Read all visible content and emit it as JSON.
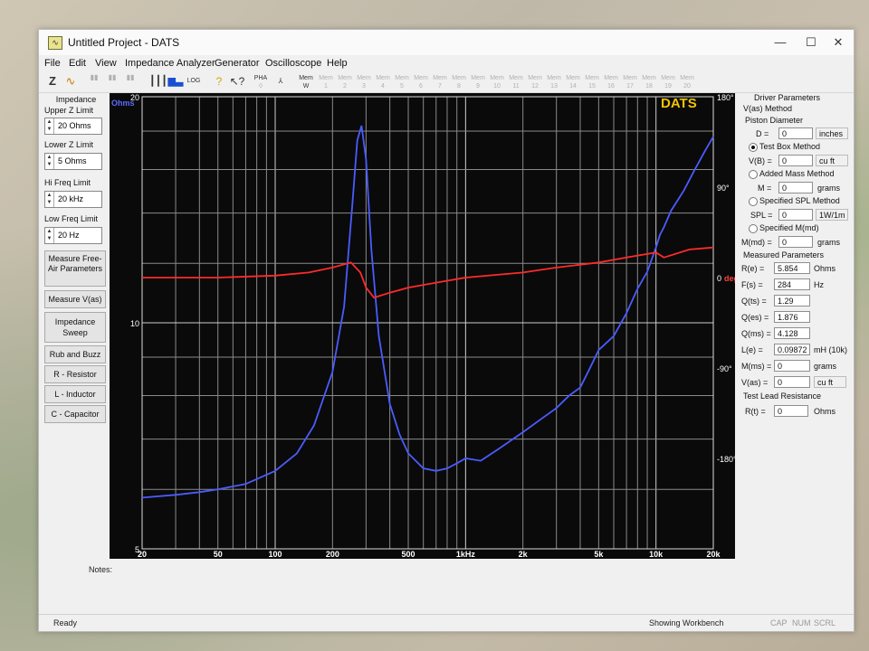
{
  "window": {
    "title": "Untitled Project - DATS",
    "app_icon": "dats-app-icon",
    "controls": [
      "—",
      "☐",
      "✕"
    ]
  },
  "menu": [
    "File",
    "Edit",
    "View",
    "Impedance Analyzer",
    "Generator",
    "Oscilloscope",
    "Help"
  ],
  "toolbar": {
    "z_label": "Z",
    "pha_label": "PHA",
    "mem_label": "Mem",
    "mem_slots": [
      "1",
      "2",
      "3",
      "4",
      "5",
      "6",
      "7",
      "8",
      "9",
      "10",
      "11",
      "12",
      "13",
      "14",
      "15",
      "16",
      "17",
      "18",
      "19",
      "20"
    ]
  },
  "sidebar": {
    "impedance_title": "Impedance",
    "upper_z_label": "Upper Z Limit",
    "upper_z_value": "20 Ohms",
    "lower_z_label": "Lower Z Limit",
    "lower_z_value": "5 Ohms",
    "hi_freq_label": "Hi Freq Limit",
    "hi_freq_value": "20 kHz",
    "low_freq_label": "Low Freq Limit",
    "low_freq_value": "20 Hz",
    "buttons": [
      "Measure Free-Air Parameters",
      "Measure V(as)",
      "Impedance Sweep",
      "Rub and Buzz",
      "R - Resistor",
      "L - Inductor",
      "C - Capacitor"
    ]
  },
  "chart_data": {
    "type": "line",
    "brand_label": "DATS",
    "ylabel": "Ohms",
    "ylabel_right": "deg",
    "x_scale": "log",
    "xlim": [
      20,
      20000
    ],
    "ylim": [
      5,
      20
    ],
    "y_scale": "log",
    "y2lim": [
      -270,
      180
    ],
    "x_ticks": [
      "20",
      "50",
      "100",
      "200",
      "500",
      "1kHz",
      "2k",
      "5k",
      "10k",
      "20k"
    ],
    "y_ticks": [
      "20",
      "10",
      "5"
    ],
    "y2_ticks": [
      "180°",
      "90°",
      "0",
      "-90°",
      "-180°"
    ],
    "grid": true,
    "series": [
      {
        "color": "#4a5cff",
        "x": [
          20,
          30,
          40,
          50,
          70,
          100,
          130,
          160,
          200,
          230,
          255,
          270,
          284,
          300,
          320,
          350,
          400,
          450,
          500,
          600,
          700,
          800,
          900,
          1000,
          1200,
          1500,
          2000,
          2500,
          3000,
          3500,
          4000,
          4500,
          5000,
          6000,
          7000,
          8000,
          9000,
          10000,
          10500,
          11000,
          12000,
          14000,
          16000,
          18000,
          20000
        ],
        "y": [
          5.85,
          5.9,
          5.95,
          6.0,
          6.1,
          6.35,
          6.7,
          7.3,
          8.6,
          10.5,
          14.5,
          17.5,
          18.3,
          16.5,
          12.5,
          9.6,
          7.8,
          7.1,
          6.7,
          6.4,
          6.35,
          6.4,
          6.5,
          6.6,
          6.55,
          6.8,
          7.15,
          7.45,
          7.7,
          8.0,
          8.2,
          8.7,
          9.2,
          9.6,
          10.3,
          11.1,
          11.7,
          12.6,
          13.1,
          13.4,
          14.1,
          15.0,
          16.0,
          16.9,
          17.7
        ]
      },
      {
        "color": "#ff2a2a",
        "x": [
          20,
          50,
          100,
          150,
          200,
          250,
          280,
          300,
          330,
          400,
          500,
          700,
          1000,
          2000,
          3000,
          5000,
          7000,
          10000,
          11000,
          15000,
          20000
        ],
        "y": [
          0,
          0,
          2,
          5,
          10,
          15,
          5,
          -10,
          -20,
          -15,
          -10,
          -5,
          0,
          5,
          10,
          15,
          20,
          25,
          20,
          28,
          30
        ]
      }
    ]
  },
  "driver_params": {
    "title": "Driver Parameters",
    "method_title": "V(as) Method",
    "piston_label": "Piston Diameter",
    "d_label": "D =",
    "d_value": "0",
    "d_unit": "inches",
    "test_box_label": "Test Box Method",
    "vb_label": "V(B) =",
    "vb_value": "0",
    "vb_unit": "cu ft",
    "added_mass_label": "Added Mass Method",
    "m_label": "M =",
    "m_value": "0",
    "m_unit": "grams",
    "spl_method_label": "Specified SPL Method",
    "spl_label": "SPL =",
    "spl_value": "0",
    "spl_unit": "1W/1m",
    "mmd_method_label": "Specified M(md)",
    "mmd_label": "M(md) =",
    "mmd_value": "0",
    "mmd_unit": "grams"
  },
  "measured_params": {
    "title": "Measured Parameters",
    "rows": [
      {
        "label": "R(e) =",
        "value": "5.854",
        "unit": "Ohms"
      },
      {
        "label": "F(s) =",
        "value": "284",
        "unit": "Hz"
      },
      {
        "label": "Q(ts) =",
        "value": "1.29",
        "unit": ""
      },
      {
        "label": "Q(es) =",
        "value": "1.876",
        "unit": ""
      },
      {
        "label": "Q(ms) =",
        "value": "4.128",
        "unit": ""
      },
      {
        "label": "L(e) =",
        "value": "0.09872",
        "unit": "mH (10k)"
      },
      {
        "label": "M(ms) =",
        "value": "0",
        "unit": "grams"
      },
      {
        "label": "V(as) =",
        "value": "0",
        "unit": "cu ft"
      }
    ]
  },
  "test_lead": {
    "title": "Test Lead Resistance",
    "label": "R(t) =",
    "value": "0",
    "unit": "Ohms"
  },
  "notes_label": "Notes:",
  "status": {
    "left": "Ready",
    "middle": "Showing Workbench",
    "cap": "CAP",
    "num": "NUM",
    "scrl": "SCRL"
  }
}
